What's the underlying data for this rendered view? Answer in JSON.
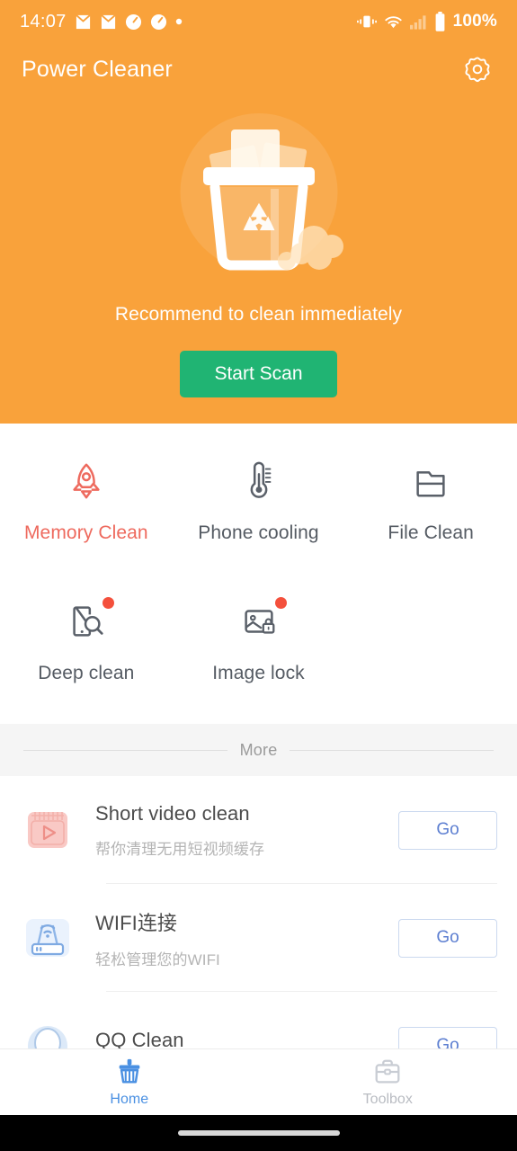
{
  "status_bar": {
    "time": "14:07",
    "battery_text": "100%",
    "left_icons": [
      "mail-icon",
      "mail-icon",
      "speedometer-icon",
      "speedometer-icon",
      "dot-icon"
    ],
    "right_icons": [
      "vibrate-icon",
      "wifi-icon",
      "signal-bars-icon",
      "battery-icon"
    ]
  },
  "app_bar": {
    "title": "Power Cleaner",
    "settings_icon": "gear-icon"
  },
  "hero": {
    "illustration": "trash-can-recycle-icon",
    "subtitle": "Recommend to clean immediately",
    "scan_button": "Start Scan",
    "background_color": "#F9A23B",
    "button_color": "#20B473"
  },
  "features": [
    {
      "label": "Memory Clean",
      "icon": "rocket-icon",
      "accent": true,
      "badge": false
    },
    {
      "label": "Phone cooling",
      "icon": "thermometer-icon",
      "accent": false,
      "badge": false
    },
    {
      "label": "File Clean",
      "icon": "folder-icon",
      "accent": false,
      "badge": false
    },
    {
      "label": "Deep clean",
      "icon": "phone-search-icon",
      "accent": false,
      "badge": true
    },
    {
      "label": "Image lock",
      "icon": "image-lock-icon",
      "accent": false,
      "badge": true
    }
  ],
  "more_divider": {
    "label": "More"
  },
  "list": [
    {
      "icon": "film-play-icon",
      "title": "Short video clean",
      "subtitle": "帮你清理无用短视频缓存",
      "action": "Go"
    },
    {
      "icon": "wifi-router-icon",
      "title": "WIFI连接",
      "subtitle": "轻松管理您的WIFI",
      "action": "Go"
    },
    {
      "icon": "qq-icon",
      "title": "QQ Clean",
      "subtitle": "",
      "action": "Go"
    }
  ],
  "bottom_nav": [
    {
      "label": "Home",
      "icon": "broom-icon",
      "active": true
    },
    {
      "label": "Toolbox",
      "icon": "briefcase-icon",
      "active": false
    }
  ],
  "colors": {
    "brand_orange": "#F9A23B",
    "accent_red": "#EE6A5E",
    "green_button": "#20B473",
    "link_blue": "#5D7FD1",
    "nav_active_blue": "#4A90E2"
  }
}
